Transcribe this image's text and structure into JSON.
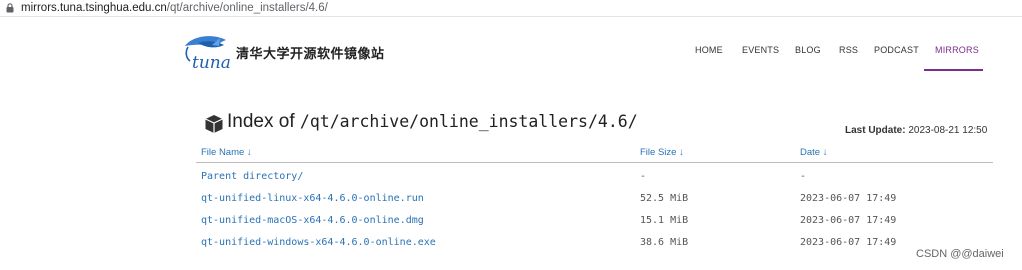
{
  "browser": {
    "url_host": "mirrors.tuna.tsinghua.edu.cn",
    "url_path": "/qt/archive/online_installers/4.6/"
  },
  "header": {
    "logo_text": "tuna",
    "site_title": "清华大学开源软件镜像站",
    "nav": [
      "HOME",
      "EVENTS",
      "BLOG",
      "RSS",
      "PODCAST",
      "MIRRORS"
    ],
    "active_nav": "MIRRORS",
    "accent_color": "#7b2d8e"
  },
  "index": {
    "icon": "box-icon",
    "title_prefix": "Index of",
    "title_path": "/qt/archive/online_installers/4.6/",
    "last_update_label": "Last Update:",
    "last_update_value": "2023-08-21 12:50"
  },
  "table": {
    "headers": [
      "File Name ↓",
      "File Size ↓",
      "Date ↓"
    ],
    "rows": [
      {
        "name": "Parent directory/",
        "size": "-",
        "date": "-"
      },
      {
        "name": "qt-unified-linux-x64-4.6.0-online.run",
        "size": "52.5 MiB",
        "date": "2023-06-07 17:49"
      },
      {
        "name": "qt-unified-macOS-x64-4.6.0-online.dmg",
        "size": "15.1 MiB",
        "date": "2023-06-07 17:49"
      },
      {
        "name": "qt-unified-windows-x64-4.6.0-online.exe",
        "size": "38.6 MiB",
        "date": "2023-06-07 17:49"
      }
    ],
    "link_color": "#2a72b5"
  },
  "watermark": "CSDN @@daiwei"
}
